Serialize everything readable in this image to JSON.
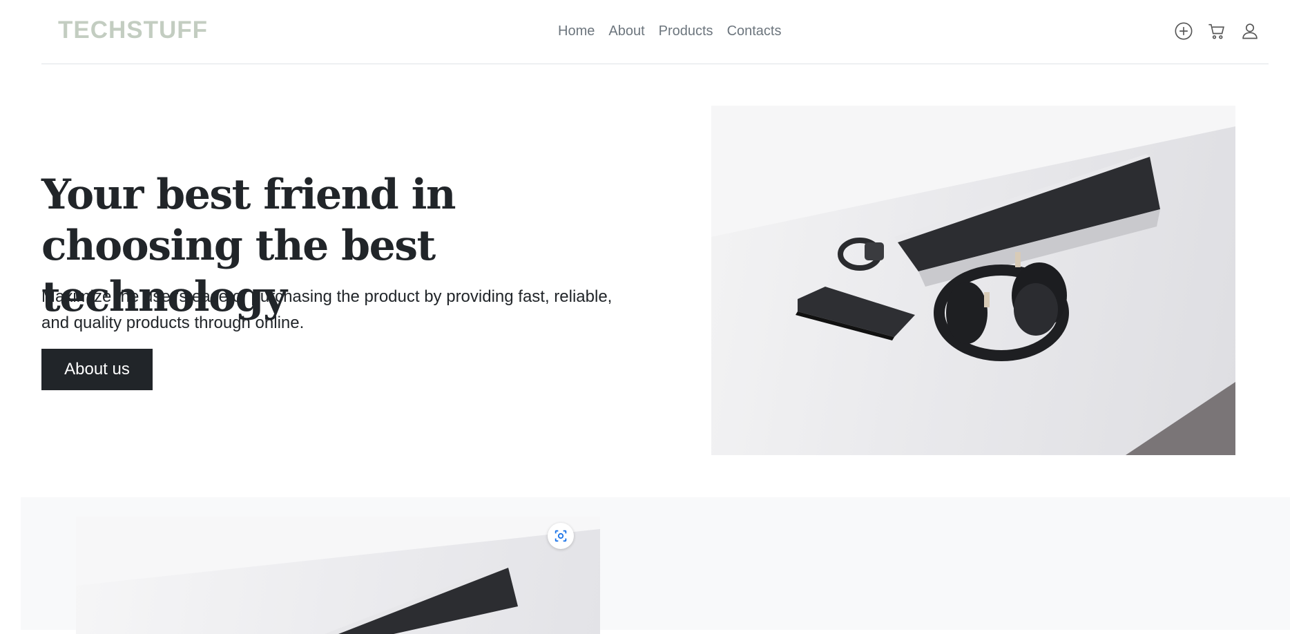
{
  "brand": {
    "name": "TECHSTUFF"
  },
  "nav": {
    "items": [
      {
        "label": "Home"
      },
      {
        "label": "About"
      },
      {
        "label": "Products"
      },
      {
        "label": "Contacts"
      }
    ],
    "icons": [
      "plus-circle-icon",
      "cart-icon",
      "user-icon"
    ]
  },
  "hero": {
    "title": "Your best friend in choosing the best technology",
    "lead": "Maximize the user's ease of purchasing the product by providing fast, reliable, and quality products through online.",
    "button_label": "About us",
    "image": "desk-with-laptop-headphones-phone-watch"
  },
  "section2": {
    "image": "desk-with-laptop-photo",
    "overlay_icon": "visual-search-icon"
  },
  "colors": {
    "brand": "#c3cdc1",
    "nav_text": "#6c757d",
    "dark": "#212529",
    "section_bg": "#f8f9fa",
    "lens_accent": "#1a73e8"
  }
}
